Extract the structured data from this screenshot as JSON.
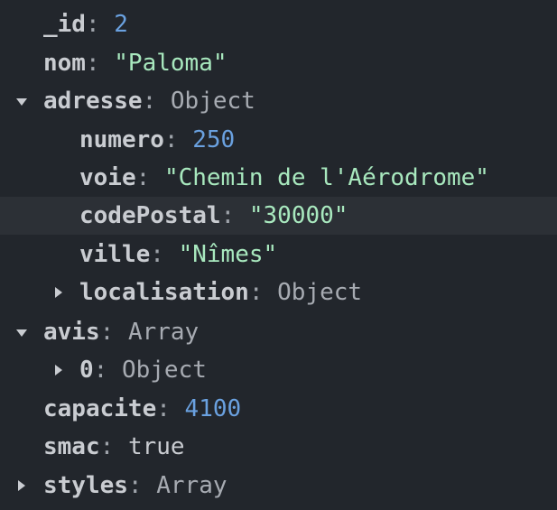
{
  "fields": {
    "id": {
      "key": "_id",
      "value": "2"
    },
    "nom": {
      "key": "nom",
      "value": "\"Paloma\""
    },
    "adresse": {
      "key": "adresse",
      "type": "Object",
      "numero": {
        "key": "numero",
        "value": "250"
      },
      "voie": {
        "key": "voie",
        "value": "\"Chemin de l'Aérodrome\""
      },
      "codePostal": {
        "key": "codePostal",
        "value": "\"30000\""
      },
      "ville": {
        "key": "ville",
        "value": "\"Nîmes\""
      },
      "localisation": {
        "key": "localisation",
        "type": "Object"
      }
    },
    "avis": {
      "key": "avis",
      "type": "Array",
      "item0": {
        "key": "0",
        "type": "Object"
      }
    },
    "capacite": {
      "key": "capacite",
      "value": "4100"
    },
    "smac": {
      "key": "smac",
      "value": "true"
    },
    "styles": {
      "key": "styles",
      "type": "Array"
    }
  },
  "punct": {
    "colon": ":"
  },
  "colors": {
    "background": "#22262c",
    "highlight_row": "#2c3036",
    "key": "#c9ccd1",
    "string": "#a8e8be",
    "number": "#6aa1e0",
    "type": "#a7abb2"
  },
  "icons": {
    "expanded": "caret-down-icon",
    "collapsed": "caret-right-icon"
  }
}
